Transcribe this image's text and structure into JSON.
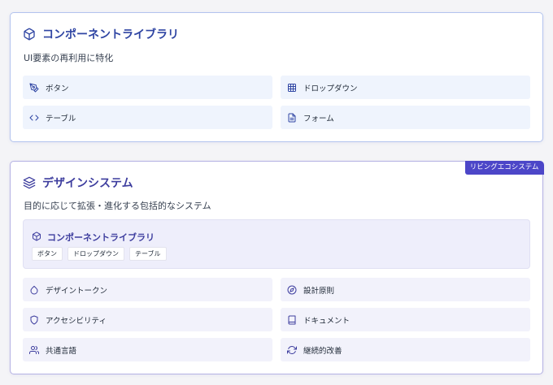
{
  "component_card": {
    "title": "コンポーネントライブラリ",
    "description": "UI要素の再利用に特化",
    "items": [
      {
        "label": "ボタン",
        "icon": "pen-tool-icon"
      },
      {
        "label": "ドロップダウン",
        "icon": "grid-icon"
      },
      {
        "label": "テーブル",
        "icon": "code-icon"
      },
      {
        "label": "フォーム",
        "icon": "file-text-icon"
      }
    ]
  },
  "design_system_card": {
    "badge": "リビングエコシステム",
    "title": "デザインシステム",
    "description": "目的に応じて拡張・進化する包括的なシステム",
    "nested": {
      "title": "コンポーネントライブラリ",
      "chips": [
        "ボタン",
        "ドロップダウン",
        "テーブル"
      ]
    },
    "items": [
      {
        "label": "デザイントークン",
        "icon": "droplet-icon"
      },
      {
        "label": "設計原則",
        "icon": "compass-icon"
      },
      {
        "label": "アクセシビリティ",
        "icon": "shield-icon"
      },
      {
        "label": "ドキュメント",
        "icon": "book-icon"
      },
      {
        "label": "共通言語",
        "icon": "users-icon"
      },
      {
        "label": "継続的改善",
        "icon": "refresh-icon"
      }
    ]
  },
  "colors": {
    "blue_accent": "#2f45a3",
    "indigo_accent": "#3d3d9e",
    "badge_bg": "#4c46c8"
  }
}
